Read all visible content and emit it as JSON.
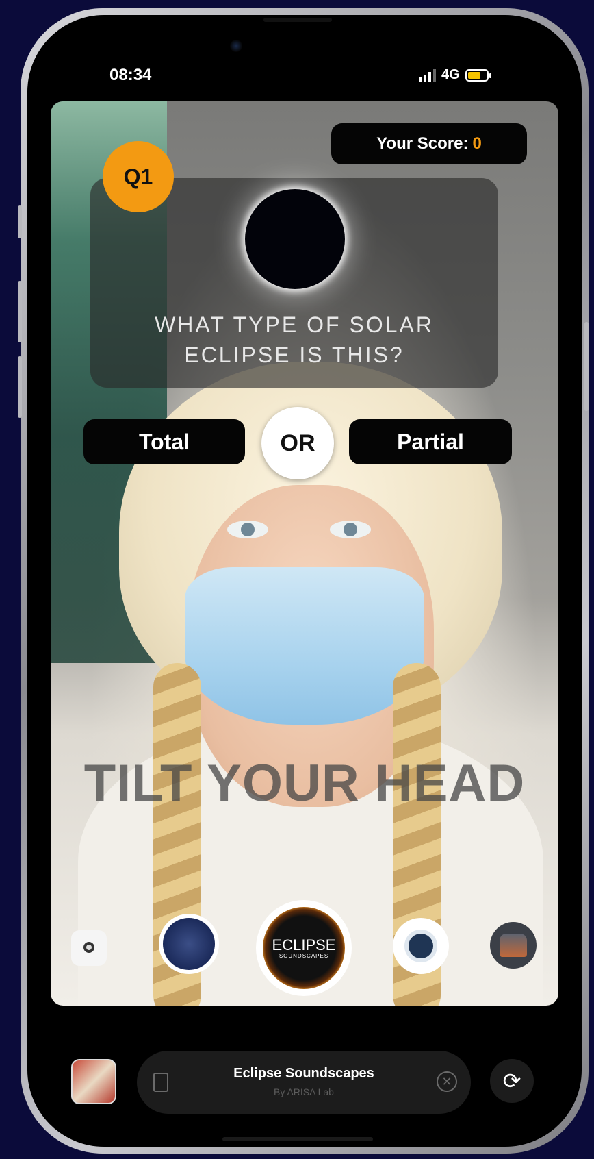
{
  "status_bar": {
    "time": "08:34",
    "network": "4G",
    "battery_color": "#f5c400"
  },
  "game": {
    "score_label": "Your Score:",
    "score_value": "0",
    "question_badge": "Q1",
    "question_line1": "WHAT TYPE OF SOLAR",
    "question_line2": "ECLIPSE IS THIS?",
    "answer_left": "Total",
    "or_label": "OR",
    "answer_right": "Partial",
    "instruction": "TILT YOUR HEAD",
    "accent_color": "#f39a12"
  },
  "lens_carousel": {
    "items": [
      {
        "icon": "lens-small-icon"
      },
      {
        "icon": "space-patch-lens-icon"
      },
      {
        "icon": "eclipse-soundscapes-lens-icon",
        "label_main": "ECLIPSE",
        "label_sub": "SOUNDSCAPES",
        "selected": true
      },
      {
        "icon": "astronaut-lens-icon"
      },
      {
        "icon": "mars-rover-lens-icon"
      }
    ]
  },
  "bottom_bar": {
    "lens_title": "Eclipse Soundscapes",
    "lens_author": "By ARISA Lab",
    "bookmark_icon": "bookmark-icon",
    "close_icon": "close-icon",
    "flip_icon": "flip-camera-icon"
  }
}
